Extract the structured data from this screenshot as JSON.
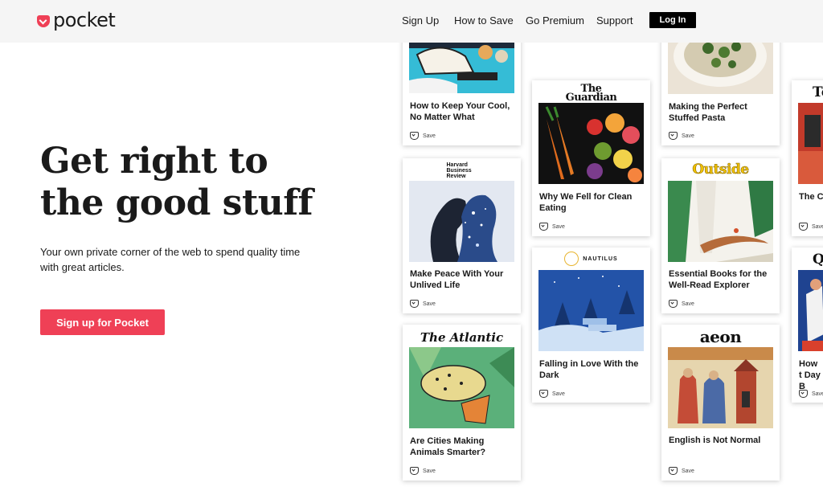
{
  "brand": {
    "logo_text": "pocket",
    "logo_color": "#ef4056"
  },
  "nav": {
    "sign_up": "Sign Up",
    "how_to_save": "How to Save",
    "go_premium": "Go Premium",
    "support": "Support",
    "log_in": "Log In"
  },
  "hero": {
    "title_line1": "Get right to",
    "title_line2": "the good stuff",
    "subtitle": "Your own private corner of the web to spend quality time with great articles.",
    "cta": "Sign up for Pocket"
  },
  "save_label": "Save",
  "cards": {
    "cool": {
      "title": "How to Keep Your Cool, No Matter What"
    },
    "clean": {
      "publisher": "The Guardian",
      "title": "Why We Fell for Clean Eating"
    },
    "pasta": {
      "title": "Making the Perfect Stuffed Pasta"
    },
    "partial_top": {
      "publisher": "Te",
      "title": "The C"
    },
    "peace": {
      "publisher": "Harvard Business Review",
      "title": "Make Peace With Your Unlived Life"
    },
    "books": {
      "publisher": "Outside",
      "title": "Essential Books for the Well-Read Explorer"
    },
    "falling": {
      "publisher": "NAUTILUS",
      "title": "Falling in Love With the Dark"
    },
    "partial_mid": {
      "publisher": "Q",
      "title": "How t Day B"
    },
    "cities": {
      "publisher": "The Atlantic",
      "title": "Are Cities Making Animals Smarter?"
    },
    "english": {
      "publisher": "aeon",
      "title": "English is Not Normal"
    }
  },
  "colors": {
    "accent": "#ef4056",
    "header_bg": "#f5f5f5",
    "text": "#1a1a1a",
    "outside_yellow": "#f2c200"
  }
}
